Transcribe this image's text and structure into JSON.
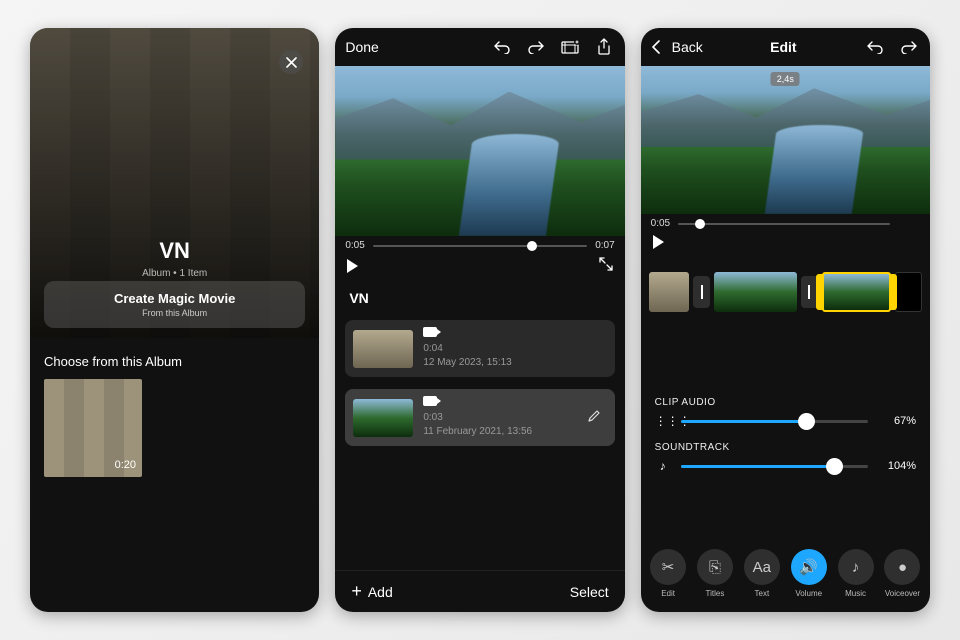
{
  "screen1": {
    "album_title": "VN",
    "album_subtitle": "Album • 1 Item",
    "magic_button_title": "Create Magic Movie",
    "magic_button_subtitle": "From this Album",
    "choose_label": "Choose from this Album",
    "thumb_duration": "0:20"
  },
  "screen2": {
    "done": "Done",
    "time_current": "0:05",
    "time_total": "0:07",
    "scrubber_position_pct": 72,
    "album_name": "VN",
    "clips": [
      {
        "duration": "0:04",
        "date": "12 May 2023, 15:13",
        "selected": false
      },
      {
        "duration": "0:03",
        "date": "11 February 2021, 13:56",
        "selected": true
      }
    ],
    "add_label": "Add",
    "select_label": "Select"
  },
  "screen3": {
    "back": "Back",
    "title": "Edit",
    "badge": "2,4s",
    "time_current": "0:05",
    "scrubber_position_pct": 8,
    "clip_audio_label": "CLIP AUDIO",
    "clip_audio_pct": 67,
    "clip_audio_pct_label": "67%",
    "soundtrack_label": "SOUNDTRACK",
    "soundtrack_pct": 82,
    "soundtrack_pct_label": "104%",
    "tools": [
      {
        "key": "edit",
        "label": "Edit",
        "glyph": "✂"
      },
      {
        "key": "titles",
        "label": "Titles",
        "glyph": "⎘"
      },
      {
        "key": "text",
        "label": "Text",
        "glyph": "Aa"
      },
      {
        "key": "volume",
        "label": "Volume",
        "glyph": "🔊",
        "active": true
      },
      {
        "key": "music",
        "label": "Music",
        "glyph": "♪"
      },
      {
        "key": "voiceover",
        "label": "Voiceover",
        "glyph": "●"
      }
    ]
  }
}
